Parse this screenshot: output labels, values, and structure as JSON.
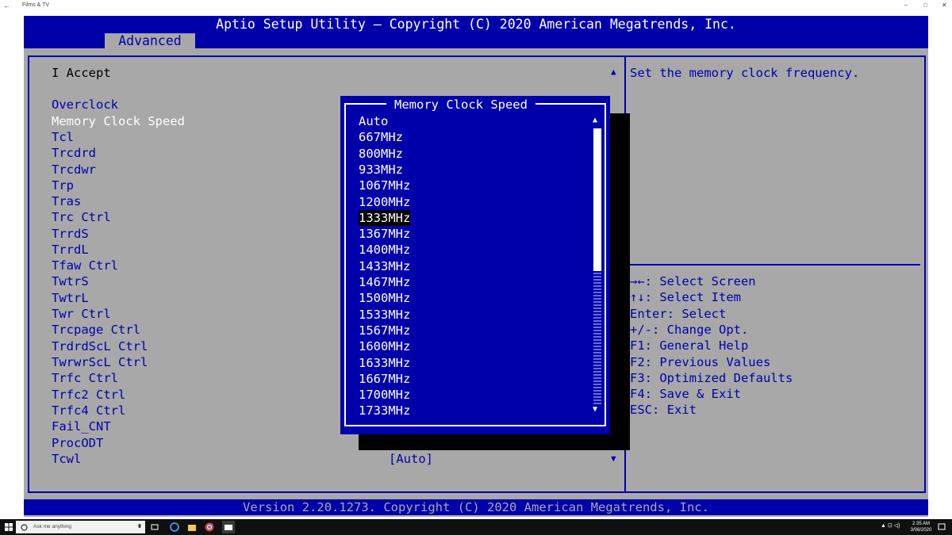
{
  "window": {
    "title": "Films & TV",
    "back_icon": "←",
    "minimize_icon": "–",
    "maximize_icon": "□",
    "close_icon": "✕"
  },
  "bios": {
    "header_title": "Aptio Setup Utility – Copyright (C) 2020 American Megatrends, Inc.",
    "active_tab": "Advanced",
    "accept_text": "I Accept",
    "menu_items": [
      "Overclock",
      "Memory Clock Speed",
      "Tcl",
      "Trcdrd",
      "Trcdwr",
      "Trp",
      "Tras",
      "Trc Ctrl",
      "TrrdS",
      "TrrdL",
      "Tfaw Ctrl",
      "TwtrS",
      "TwtrL",
      "Twr Ctrl",
      "Trcpage Ctrl",
      "TrdrdScL Ctrl",
      "TwrwrScL Ctrl",
      "Trfc Ctrl",
      "Trfc2 Ctrl",
      "Trfc4 Ctrl",
      "Fail_CNT",
      "ProcODT",
      "Tcwl"
    ],
    "tcwl_value": "[Auto]",
    "help_text": "Set the memory clock frequency.",
    "keys": [
      "→←: Select Screen",
      "↑↓: Select Item",
      "Enter: Select",
      "+/-: Change Opt.",
      "F1: General Help",
      "F2: Previous Values",
      "F3: Optimized Defaults",
      "F4: Save & Exit",
      "ESC: Exit"
    ],
    "footer": "Version 2.20.1273. Copyright (C) 2020 American Megatrends, Inc."
  },
  "popup": {
    "title": "Memory Clock Speed",
    "options": [
      "Auto",
      "667MHz",
      "800MHz",
      "933MHz",
      "1067MHz",
      "1200MHz",
      "1333MHz",
      "1367MHz",
      "1400MHz",
      "1433MHz",
      "1467MHz",
      "1500MHz",
      "1533MHz",
      "1567MHz",
      "1600MHz",
      "1633MHz",
      "1667MHz",
      "1700MHz",
      "1733MHz"
    ],
    "selected_option": "1333MHz"
  },
  "taskbar": {
    "search_placeholder": "Ask me anything",
    "time": "2:35 AM",
    "date": "3/08/2020"
  },
  "colors": {
    "bios_blue": "#0000aa",
    "bios_gray": "#a8a8a8",
    "white": "#ffffff"
  }
}
